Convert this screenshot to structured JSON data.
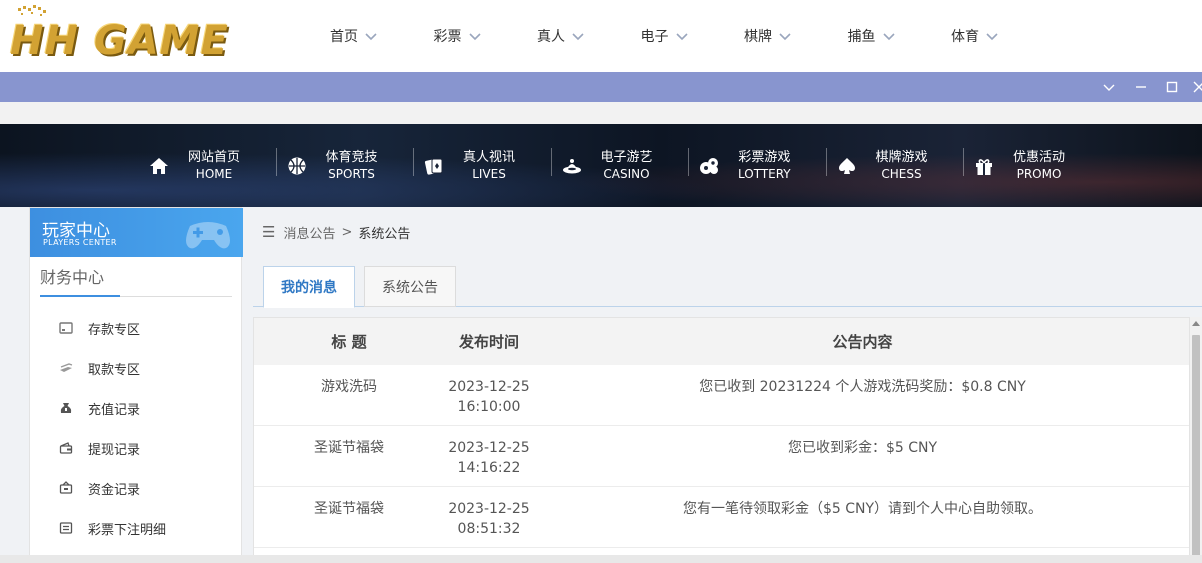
{
  "brand": {
    "logo_text": "HH GAME",
    "gold": "#d2a233"
  },
  "top_menu": [
    {
      "label": "首页"
    },
    {
      "label": "彩票"
    },
    {
      "label": "真人"
    },
    {
      "label": "电子"
    },
    {
      "label": "棋牌"
    },
    {
      "label": "捕鱼"
    },
    {
      "label": "体育"
    }
  ],
  "window_bar": {
    "color": "#8895cf",
    "buttons": [
      "chevron-down-icon",
      "minimize-icon",
      "maximize-icon",
      "close-icon"
    ]
  },
  "banner_nav": [
    {
      "cn": "网站首页",
      "en": "HOME",
      "icon": "home-icon"
    },
    {
      "cn": "体育竞技",
      "en": "SPORTS",
      "icon": "basketball-icon"
    },
    {
      "cn": "真人视讯",
      "en": "LIVES",
      "icon": "cards-icon"
    },
    {
      "cn": "电子游艺",
      "en": "CASINO",
      "icon": "slot-machine-icon"
    },
    {
      "cn": "彩票游戏",
      "en": "LOTTERY",
      "icon": "lottery-balls-icon"
    },
    {
      "cn": "棋牌游戏",
      "en": "CHESS",
      "icon": "spade-icon"
    },
    {
      "cn": "优惠活动",
      "en": "PROMO",
      "icon": "gift-icon"
    }
  ],
  "sidebar": {
    "title_cn": "玩家中心",
    "title_en": "PLAYERS CENTER",
    "section": "财务中心",
    "items": [
      {
        "label": "存款专区",
        "icon": "deposit-card-icon"
      },
      {
        "label": "取款专区",
        "icon": "withdraw-cash-icon"
      },
      {
        "label": "充值记录",
        "icon": "money-bag-icon"
      },
      {
        "label": "提现记录",
        "icon": "wallet-icon"
      },
      {
        "label": "资金记录",
        "icon": "funds-icon"
      },
      {
        "label": "彩票下注明细",
        "icon": "ticket-list-icon"
      }
    ]
  },
  "breadcrumb": {
    "parent": "消息公告",
    "separator": ">",
    "current": "系统公告"
  },
  "tabs": [
    {
      "label": "我的消息",
      "active": true
    },
    {
      "label": "系统公告",
      "active": false
    }
  ],
  "table": {
    "headers": [
      "标 题",
      "发布时间",
      "公告内容"
    ],
    "rows": [
      {
        "title": "游戏洗码",
        "date": "2023-12-25",
        "time": "16:10:00",
        "content": "您已收到 20231224 个人游戏洗码奖励：$0.8 CNY"
      },
      {
        "title": "圣诞节福袋",
        "date": "2023-12-25",
        "time": "14:16:22",
        "content": "您已收到彩金：$5 CNY"
      },
      {
        "title": "圣诞节福袋",
        "date": "2023-12-25",
        "time": "08:51:32",
        "content": "您有一笔待领取彩金（$5 CNY）请到个人中心自助领取。"
      }
    ]
  },
  "accent": "#2f78c4"
}
